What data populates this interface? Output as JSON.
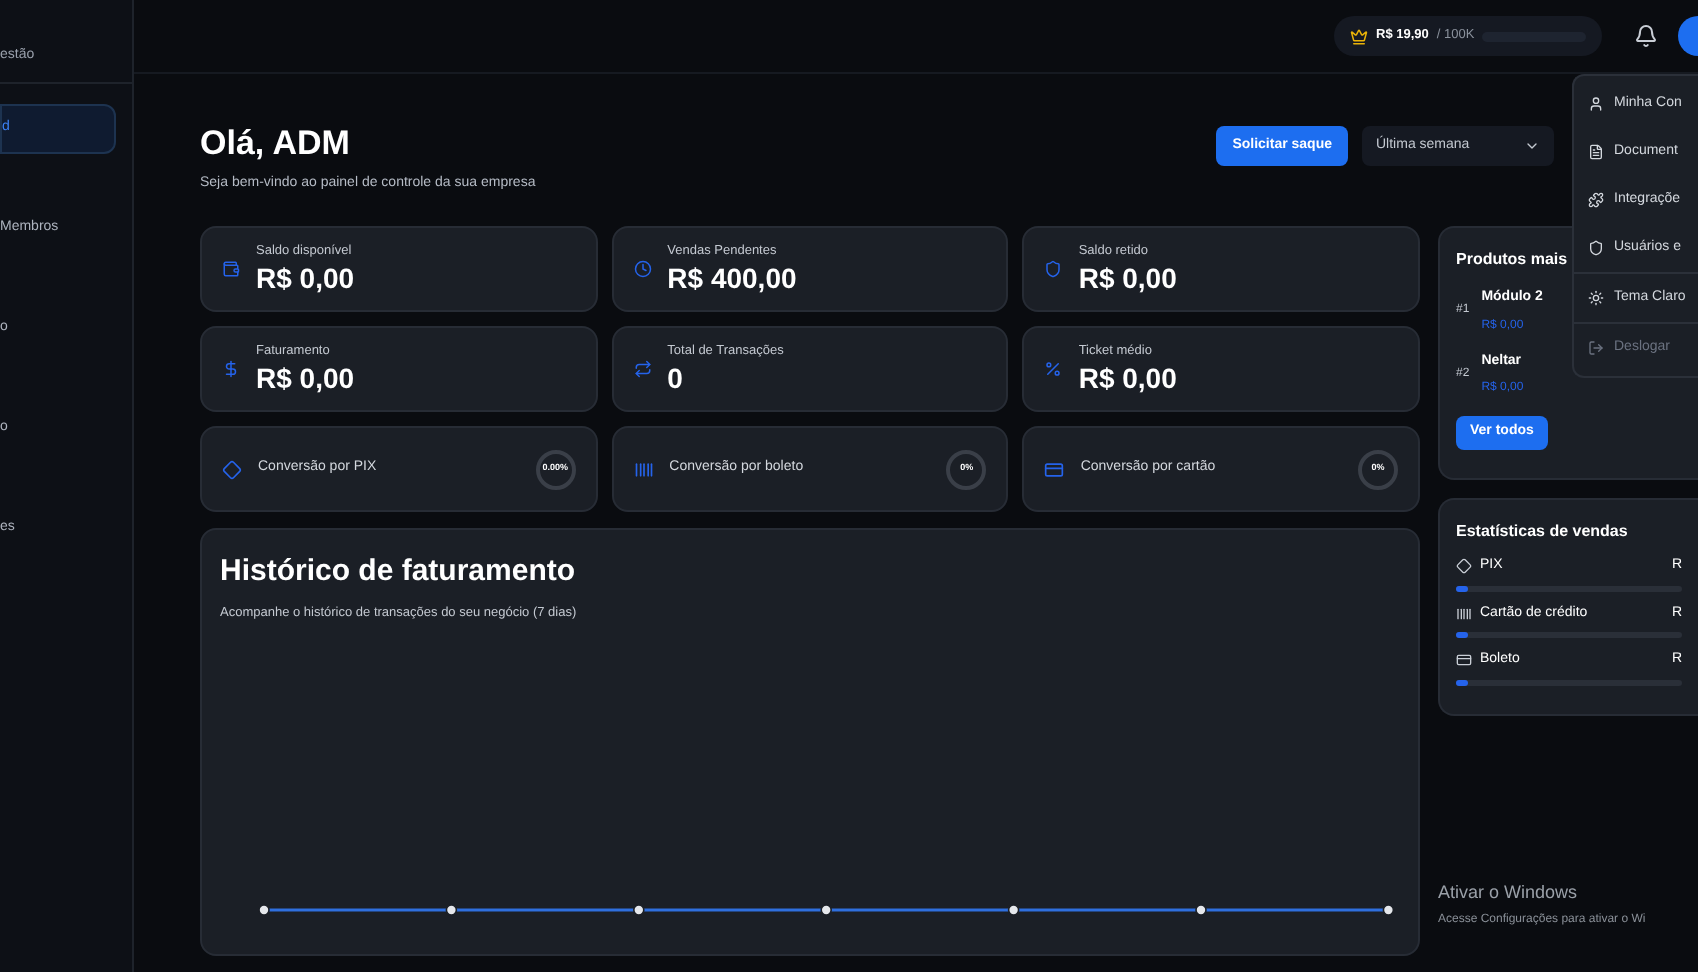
{
  "sidebar": {
    "header": "estão",
    "items": [
      {
        "label": "d",
        "selected": true
      },
      {
        "label": "Membros",
        "selected": false
      },
      {
        "label": "o",
        "selected": false
      },
      {
        "label": "o",
        "selected": false
      },
      {
        "label": "es",
        "selected": false
      }
    ]
  },
  "topbar": {
    "balance": "R$ 19,90",
    "limit": "/ 100K"
  },
  "user_menu": {
    "items": [
      {
        "label": "Minha Con",
        "disabled": false
      },
      {
        "label": "Document",
        "disabled": false
      },
      {
        "label": "Integraçõe",
        "disabled": false
      },
      {
        "label": "Usuários e",
        "disabled": false
      },
      {
        "label": "Tema Claro",
        "disabled": false
      },
      {
        "label": "Deslogar",
        "disabled": true
      }
    ]
  },
  "header": {
    "title": "Olá, ADM",
    "subtitle": "Seja bem-vindo ao painel de controle da sua empresa",
    "button": "Solicitar saque",
    "period": "Última semana"
  },
  "stat_cards": [
    {
      "label": "Saldo disponível",
      "value": "R$ 0,00"
    },
    {
      "label": "Vendas Pendentes",
      "value": "R$ 400,00"
    },
    {
      "label": "Saldo retido",
      "value": "R$ 0,00"
    },
    {
      "label": "Faturamento",
      "value": "R$ 0,00"
    },
    {
      "label": "Total de Transações",
      "value": "0"
    },
    {
      "label": "Ticket médio",
      "value": "R$ 0,00"
    }
  ],
  "conversion_cards": [
    {
      "label": "Conversão por PIX",
      "rate": "0.00%"
    },
    {
      "label": "Conversão por boleto",
      "rate": "0%"
    },
    {
      "label": "Conversão por cartão",
      "rate": "0%"
    }
  ],
  "history": {
    "title": "Histórico de faturamento",
    "subtitle": "Acompanhe o histórico de transações do seu negócio (7 dias)"
  },
  "top_products": {
    "title": "Produtos mais",
    "items": [
      {
        "rank": "#1",
        "name": "Módulo 2",
        "price": "R$ 0,00"
      },
      {
        "rank": "#2",
        "name": "Neltar",
        "price": "R$ 0,00"
      }
    ],
    "button": "Ver todos"
  },
  "sales_stats": {
    "title": "Estatísticas de vendas",
    "items": [
      {
        "label": "PIX",
        "value": "R",
        "level": 0.05
      },
      {
        "label": "Cartão de crédito",
        "value": "R",
        "level": 0.05
      },
      {
        "label": "Boleto",
        "value": "R",
        "level": 0.05
      }
    ]
  },
  "os_notice": {
    "title": "Ativar o Windows",
    "text": "Acesse Configurações para ativar o Wi"
  }
}
